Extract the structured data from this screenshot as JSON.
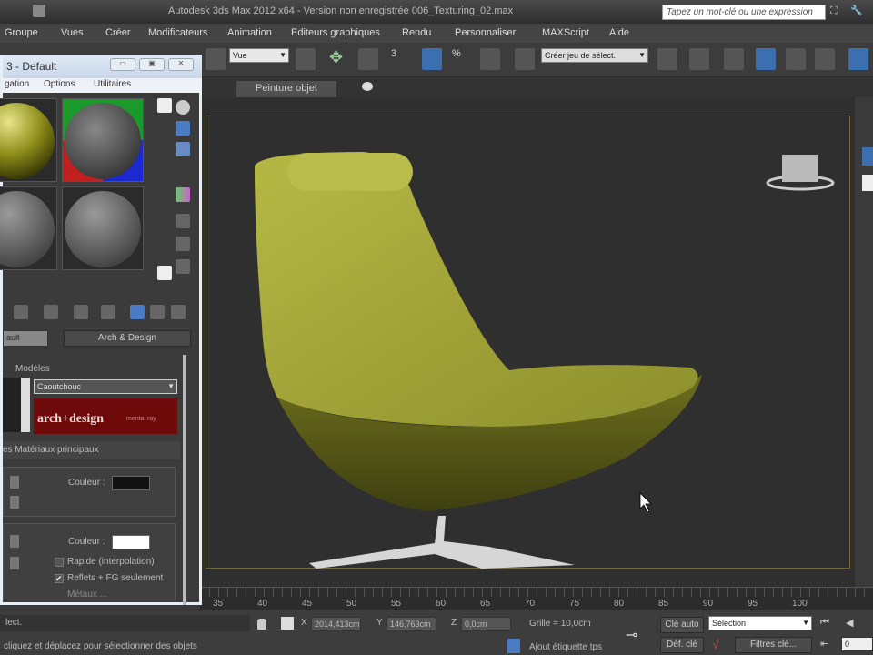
{
  "window": {
    "title": "Autodesk 3ds Max 2012 x64 - Version non enregistrée  006_Texturing_02.max",
    "search_placeholder": "Tapez un mot-clé ou une expression"
  },
  "menu": [
    "Groupe",
    "Vues",
    "Créer",
    "Modificateurs",
    "Animation",
    "Editeurs graphiques",
    "Rendu",
    "Personnaliser",
    "MAXScript",
    "Aide"
  ],
  "toolbar": {
    "view_dropdown": "Vue",
    "selection_set": "Créer jeu de sélect.",
    "snap_label": "3"
  },
  "tabs": {
    "paint": "Peinture objet"
  },
  "material_editor": {
    "title": "3 - Default",
    "menu": [
      "gation",
      "Options",
      "Utilitaires"
    ],
    "material_name": "ault",
    "material_type": "Arch & Design",
    "templates_label": "Modèles",
    "template_value": "Caoutchouc",
    "banner": "arch+design",
    "banner_sub": "mental ray",
    "rollout": "es Matériaux principaux",
    "color_label_1": "Couleur :",
    "color_label_2": "Couleur :",
    "color_1": "#111111",
    "color_2": "#ffffff",
    "checkbox_fast": "Rapide (interpolation)",
    "checkbox_reflect": "Reflets + FG seulement",
    "checkbox_third": "Métaux ... ",
    "reflect_checked": true
  },
  "timeline": {
    "ticks": [
      "35",
      "40",
      "45",
      "50",
      "55",
      "60",
      "65",
      "70",
      "75",
      "80",
      "85",
      "90",
      "95",
      "100"
    ]
  },
  "status": {
    "line1": "lect.",
    "line2": "cliquez et déplacez pour sélectionner des objets",
    "x": "2014,413cm",
    "y": "146,763cm",
    "z": "0,0cm",
    "grid": "Grille = 10,0cm",
    "add_tag": "Ajout étiquette tps",
    "auto_key": "Clé auto",
    "set_key": "Déf. clé",
    "key_mode": "Sélection",
    "key_filters": "Filtres clé...",
    "frame": "0",
    "x_label": "X",
    "y_label": "Y",
    "z_label": "Z"
  }
}
